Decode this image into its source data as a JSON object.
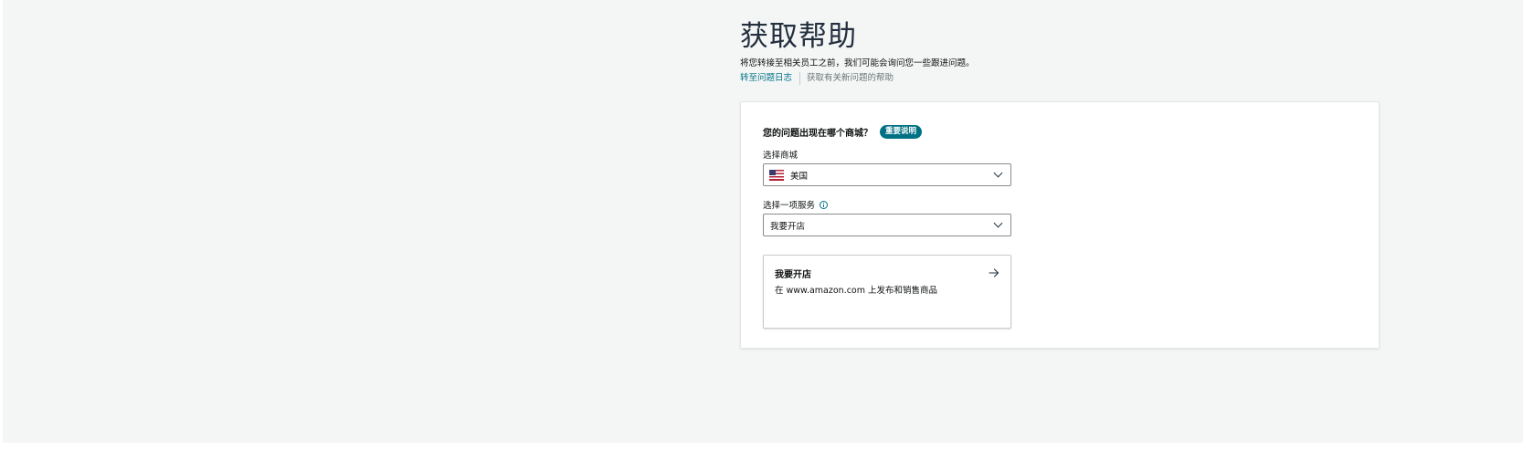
{
  "header": {
    "title": "获取帮助",
    "subtitle": "将您转接至相关员工之前，我们可能会询问您一些跟进问题。",
    "link_case_log": "转至问题日志",
    "link_new_issue_help": "获取有关新问题的帮助"
  },
  "form": {
    "question": "您的问题出现在哪个商城？",
    "badge": "重要说明",
    "marketplace_label": "选择商城",
    "marketplace_value": "美国",
    "marketplace_flag_icon": "us-flag-icon",
    "service_label": "选择一项服务",
    "service_value": "我要开店"
  },
  "option_card": {
    "title": "我要开店",
    "description": "在 www.amazon.com 上发布和销售商品",
    "icon": "arrow-right-icon"
  },
  "colors": {
    "page_background": "#f4f6f6",
    "link": "#007185",
    "badge_background": "#007185",
    "title": "#232f3e"
  }
}
